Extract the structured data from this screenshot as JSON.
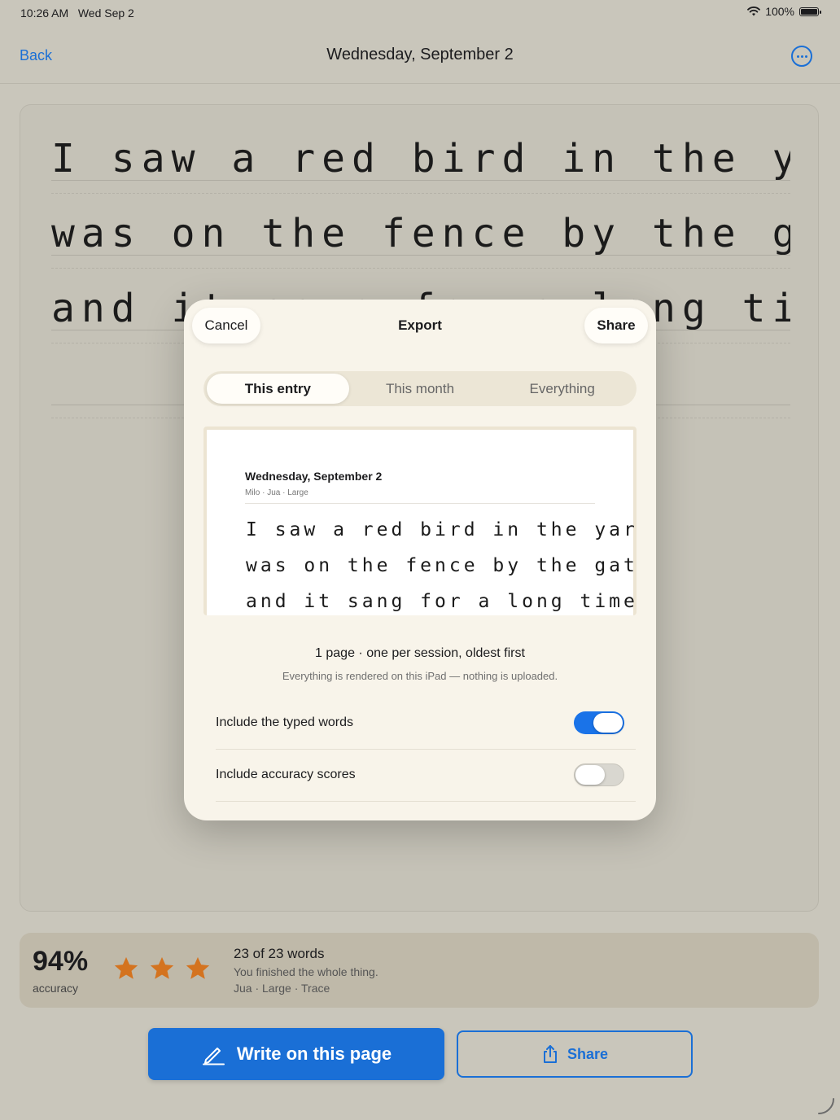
{
  "status": {
    "time": "10:26 AM",
    "date": "Wed Sep 2",
    "battery": "100%"
  },
  "nav": {
    "back": "Back",
    "title": "Wednesday, September 2"
  },
  "paper": {
    "lines": [
      "I saw a red bird in the yard. It",
      "was on the fence by the gate",
      "and it sang for a long time"
    ]
  },
  "modal": {
    "cancel": "Cancel",
    "title": "Export",
    "share": "Share",
    "segments": [
      "This entry",
      "This month",
      "Everything"
    ],
    "selected_segment": "This entry",
    "preview": {
      "date": "Wednesday, September 2",
      "meta": "Milo  ·  Jua · Large",
      "lines": [
        "I saw a red bird in the yard. It",
        "was on the fence by the gate",
        "and it sang for a long time"
      ]
    },
    "pages": "1 page  ·  one per session, oldest first",
    "note": "Everything is rendered on this iPad — nothing is uploaded.",
    "options": [
      {
        "label": "Include the typed words",
        "on": true
      },
      {
        "label": "Include accuracy scores",
        "on": false
      }
    ]
  },
  "stats": {
    "percent": "94%",
    "accuracy_label": "accuracy",
    "stars": 3,
    "words": "23 of 23 words",
    "finish": "You finished the whole thing.",
    "meta": "Jua · Large · Trace",
    "star_color": "#d4731f"
  },
  "actions": {
    "write": "Write on this page",
    "share": "Share"
  },
  "colors": {
    "accent": "#1a6fd6"
  }
}
